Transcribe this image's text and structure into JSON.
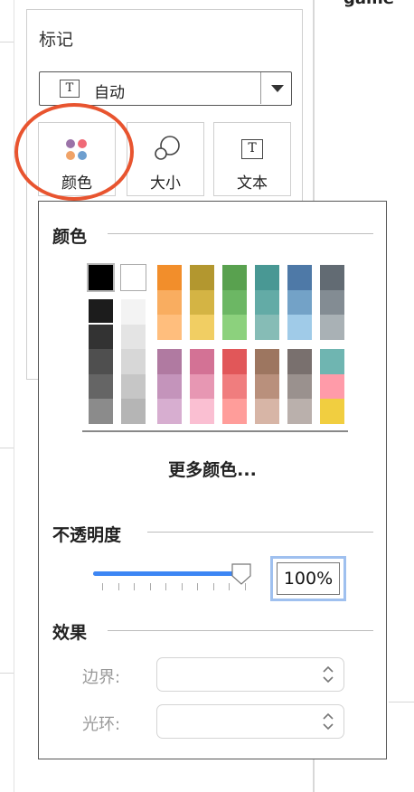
{
  "background": {
    "partial_text": "game"
  },
  "marks": {
    "title": "标记",
    "mark_type": {
      "icon": "text-T-icon",
      "label": "自动"
    },
    "buttons": [
      {
        "name": "color",
        "label": "颜色",
        "icon": "color-dots-icon"
      },
      {
        "name": "size",
        "label": "大小",
        "icon": "size-circles-icon"
      },
      {
        "name": "text",
        "label": "文本",
        "icon": "text-T-icon"
      }
    ]
  },
  "color_popup": {
    "title": "颜色",
    "swatch_columns": [
      {
        "top": [
          "#000000"
        ],
        "bottom": [
          "#1c1c1c",
          "#333333",
          "#4f4f4f",
          "#656565",
          "#8b8b8b"
        ]
      },
      {
        "top": [
          "#ffffff"
        ],
        "bottom": [
          "#f3f3f3",
          "#e4e4e4",
          "#d7d7d7",
          "#c6c6c6",
          "#b5b5b5"
        ]
      },
      {
        "top": [
          "#f28e2b",
          "#f9ad60",
          "#ffbe7d"
        ],
        "bottom": [
          "#b07aa1",
          "#c494bb",
          "#d7aed0"
        ]
      },
      {
        "top": [
          "#b3972f",
          "#d4b444",
          "#f1ce63"
        ],
        "bottom": [
          "#d37295",
          "#e797b3",
          "#fabfd2"
        ]
      },
      {
        "top": [
          "#59a14f",
          "#6cb764",
          "#8cd17d"
        ],
        "bottom": [
          "#e15759",
          "#f07d7e",
          "#ff9d9a"
        ]
      },
      {
        "top": [
          "#499894",
          "#63aba6",
          "#86bcb6"
        ],
        "bottom": [
          "#9d7660",
          "#b9907c",
          "#d7b5a6"
        ]
      },
      {
        "top": [
          "#4e79a7",
          "#73a2c7",
          "#a0cbe8"
        ],
        "bottom": [
          "#79706e",
          "#9a918e",
          "#bab0ac"
        ]
      },
      {
        "top": [
          "#626b73",
          "#838c93",
          "#a9b1b5"
        ],
        "bottom": [
          "#6fb5b1",
          "#ff9ba9",
          "#f1ce40"
        ]
      }
    ],
    "more_colors": "更多颜色...",
    "opacity": {
      "title": "不透明度",
      "value": 1.0,
      "value_text": "100%"
    },
    "effects": {
      "title": "效果",
      "border_label": "边界:",
      "halo_label": "光环:",
      "border_value": "",
      "halo_value": ""
    },
    "accent_color": "#3d86f4",
    "highlight_color": "#e8542f"
  }
}
